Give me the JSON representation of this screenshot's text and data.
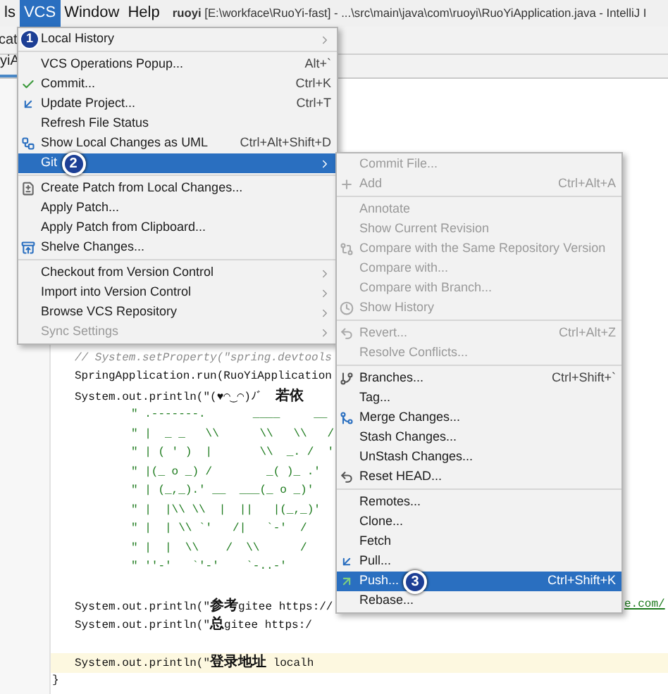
{
  "menu_bar": {
    "items": [
      {
        "label": "ls",
        "selected": false
      },
      {
        "label": "VCS",
        "selected": true,
        "callout": "1"
      },
      {
        "label": "Window",
        "selected": false
      },
      {
        "label": "Help",
        "selected": false
      }
    ],
    "title_project": "ruoyi",
    "title_path": "[E:\\workface\\RuoYi-fast] - ...\\src\\main\\java\\com\\ruoyi\\RuoYiApplication.java - IntelliJ I"
  },
  "toolbar_label": "cat",
  "editor_tab": "yiA",
  "vcs_menu": {
    "groups": [
      [
        {
          "label": "Local History",
          "submenu": true,
          "disabled": false,
          "selected": false
        }
      ],
      [
        {
          "label": "VCS Operations Popup...",
          "shortcut": "Alt+`",
          "submenu": false,
          "disabled": false,
          "selected": false
        },
        {
          "label": "Commit...",
          "shortcut": "Ctrl+K",
          "submenu": false,
          "disabled": false,
          "selected": false
        },
        {
          "label": "Update Project...",
          "shortcut": "Ctrl+T",
          "submenu": false,
          "disabled": false,
          "selected": false
        },
        {
          "label": "Refresh File Status",
          "submenu": false,
          "disabled": false,
          "selected": false
        },
        {
          "label": "Show Local Changes as UML",
          "shortcut": "Ctrl+Alt+Shift+D",
          "submenu": false,
          "disabled": false,
          "selected": false
        },
        {
          "label": "Git",
          "submenu": true,
          "disabled": false,
          "selected": true,
          "callout": "2"
        }
      ],
      [
        {
          "label": "Create Patch from Local Changes...",
          "submenu": false,
          "disabled": false,
          "selected": false
        },
        {
          "label": "Apply Patch...",
          "submenu": false,
          "disabled": false,
          "selected": false
        },
        {
          "label": "Apply Patch from Clipboard...",
          "submenu": false,
          "disabled": false,
          "selected": false
        },
        {
          "label": "Shelve Changes...",
          "submenu": false,
          "disabled": false,
          "selected": false
        }
      ],
      [
        {
          "label": "Checkout from Version Control",
          "submenu": true,
          "disabled": false,
          "selected": false
        },
        {
          "label": "Import into Version Control",
          "submenu": true,
          "disabled": false,
          "selected": false
        },
        {
          "label": "Browse VCS Repository",
          "submenu": true,
          "disabled": false,
          "selected": false
        },
        {
          "label": "Sync Settings",
          "submenu": true,
          "disabled": true,
          "selected": false
        }
      ]
    ]
  },
  "git_submenu": {
    "groups": [
      [
        {
          "label": "Commit File...",
          "submenu": false,
          "disabled": true,
          "selected": false
        },
        {
          "label": "Add",
          "shortcut": "Ctrl+Alt+A",
          "submenu": false,
          "disabled": true,
          "selected": false
        }
      ],
      [
        {
          "label": "Annotate",
          "submenu": false,
          "disabled": true,
          "selected": false
        },
        {
          "label": "Show Current Revision",
          "submenu": false,
          "disabled": true,
          "selected": false
        },
        {
          "label": "Compare with the Same Repository Version",
          "submenu": false,
          "disabled": true,
          "selected": false
        },
        {
          "label": "Compare with...",
          "submenu": false,
          "disabled": true,
          "selected": false
        },
        {
          "label": "Compare with Branch...",
          "submenu": false,
          "disabled": true,
          "selected": false
        },
        {
          "label": "Show History",
          "submenu": false,
          "disabled": true,
          "selected": false
        }
      ],
      [
        {
          "label": "Revert...",
          "shortcut": "Ctrl+Alt+Z",
          "submenu": false,
          "disabled": true,
          "selected": false
        },
        {
          "label": "Resolve Conflicts...",
          "submenu": false,
          "disabled": true,
          "selected": false
        }
      ],
      [
        {
          "label": "Branches...",
          "shortcut": "Ctrl+Shift+`",
          "submenu": false,
          "disabled": false,
          "selected": false
        },
        {
          "label": "Tag...",
          "submenu": false,
          "disabled": false,
          "selected": false
        },
        {
          "label": "Merge Changes...",
          "submenu": false,
          "disabled": false,
          "selected": false
        },
        {
          "label": "Stash Changes...",
          "submenu": false,
          "disabled": false,
          "selected": false
        },
        {
          "label": "UnStash Changes...",
          "submenu": false,
          "disabled": false,
          "selected": false
        },
        {
          "label": "Reset HEAD...",
          "submenu": false,
          "disabled": false,
          "selected": false
        }
      ],
      [
        {
          "label": "Remotes...",
          "submenu": false,
          "disabled": false,
          "selected": false
        },
        {
          "label": "Clone...",
          "submenu": false,
          "disabled": false,
          "selected": false
        },
        {
          "label": "Fetch",
          "submenu": false,
          "disabled": false,
          "selected": false
        },
        {
          "label": "Pull...",
          "submenu": false,
          "disabled": false,
          "selected": false
        },
        {
          "label": "Push...",
          "shortcut": "Ctrl+Shift+K",
          "submenu": false,
          "disabled": false,
          "selected": true,
          "callout": "3"
        },
        {
          "label": "Rebase...",
          "submenu": false,
          "disabled": false,
          "selected": false
        }
      ]
    ]
  },
  "editor": {
    "lines": [
      {
        "kind": "comment",
        "text": "// System.setProperty(\"spring.devtools"
      },
      {
        "kind": "code",
        "text": "SpringApplication.run(RuoYiApplication"
      },
      {
        "kind": "code",
        "text": "System.out.println(\"(♥◠‿◠)ﾉﾞ  若依"
      },
      {
        "kind": "ascii",
        "text": "\" .-------.       ____     __"
      },
      {
        "kind": "ascii",
        "text": "\" |  _ _   \\\\      \\\\   \\\\   /"
      },
      {
        "kind": "ascii",
        "text": "\" | ( ' )  |       \\\\  _. /  '"
      },
      {
        "kind": "ascii",
        "text": "\" |(_ o _) /        _( )_ .'"
      },
      {
        "kind": "ascii",
        "text": "\" | (_,_).' __  ___(_ o _)'"
      },
      {
        "kind": "ascii",
        "text": "\" |  |\\\\ \\\\  |  ||   |(_,_)'"
      },
      {
        "kind": "ascii",
        "text": "\" |  | \\\\ `'   /|   `-'  /"
      },
      {
        "kind": "ascii",
        "text": "\" |  |  \\\\    /  \\\\      /"
      },
      {
        "kind": "ascii",
        "text": "\" ''-'   `'-'    `-..-'"
      },
      {
        "kind": "blank"
      },
      {
        "kind": "code",
        "text": "System.out.println(\"参考gitee https://",
        "tail": "e.com/"
      },
      {
        "kind": "code",
        "text": "System.out.println(\"总gitee https:/"
      },
      {
        "kind": "blank"
      },
      {
        "kind": "code",
        "text": "System.out.println(\"登录地址 localh",
        "current": true
      },
      {
        "kind": "outer",
        "text": "}"
      }
    ]
  }
}
